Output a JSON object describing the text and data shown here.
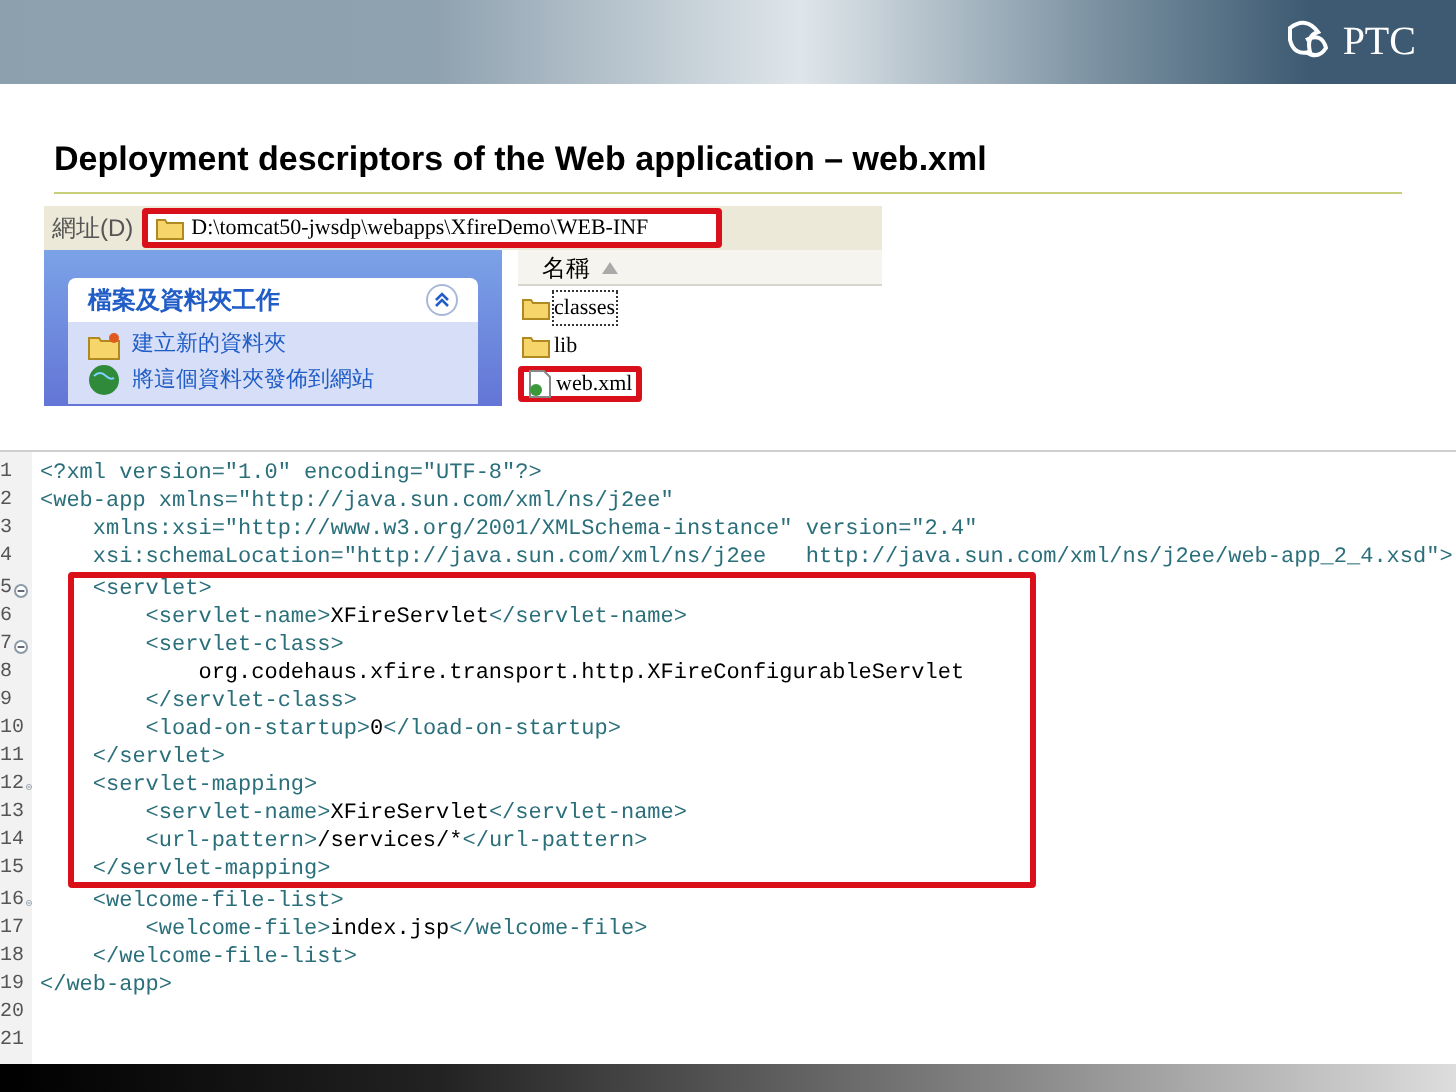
{
  "header": {
    "logo": "PTC"
  },
  "title": "Deployment descriptors of the Web application – web.xml",
  "explorer": {
    "address_label": "網址(D)",
    "address": "D:\\tomcat50-jwsdp\\webapps\\XfireDemo\\WEB-INF",
    "address_highlighted": true,
    "task_panel": {
      "title": "檔案及資料夾工作",
      "expanded": true,
      "tasks": [
        {
          "label": "建立新的資料夾",
          "kind": "folder"
        },
        {
          "label": "將這個資料夾發佈到網站",
          "kind": "globe"
        }
      ]
    },
    "column": "名稱",
    "files": [
      {
        "name": "classes",
        "kind": "folder",
        "selected": true,
        "highlighted": false
      },
      {
        "name": "lib",
        "kind": "folder",
        "selected": false,
        "highlighted": false
      },
      {
        "name": "web.xml",
        "kind": "xml",
        "selected": false,
        "highlighted": true
      }
    ]
  },
  "code": [
    {
      "highlighted": false,
      "lines": [
        {
          "number": "1",
          "foldable": false,
          "segments": [
            {
              "kind": "markup",
              "text": "<?xml version=\"1.0\" encoding=\"UTF-8\"?>"
            }
          ]
        },
        {
          "number": "2",
          "foldable": false,
          "segments": [
            {
              "kind": "markup",
              "text": "<web-app xmlns=\"http://java.sun.com/xml/ns/j2ee\""
            }
          ]
        },
        {
          "number": "3",
          "foldable": false,
          "segments": [
            {
              "kind": "markup",
              "text": "    xmlns:xsi=\"http://www.w3.org/2001/XMLSchema-instance\" version=\"2.4\""
            }
          ]
        },
        {
          "number": "4",
          "foldable": false,
          "segments": [
            {
              "kind": "markup",
              "text": "    xsi:schemaLocation=\"http://java.sun.com/xml/ns/j2ee   http://java.sun.com/xml/ns/j2ee/web-app_2_4.xsd\">"
            }
          ]
        }
      ]
    },
    {
      "highlighted": true,
      "lines": [
        {
          "number": "5",
          "foldable": true,
          "segments": [
            {
              "kind": "markup",
              "text": "    <servlet>"
            }
          ]
        },
        {
          "number": "6",
          "foldable": false,
          "segments": [
            {
              "kind": "markup",
              "text": "        <servlet-name>"
            },
            {
              "kind": "content",
              "text": "XFireServlet"
            },
            {
              "kind": "markup",
              "text": "</servlet-name>"
            }
          ]
        },
        {
          "number": "7",
          "foldable": true,
          "segments": [
            {
              "kind": "markup",
              "text": "        <servlet-class>"
            }
          ]
        },
        {
          "number": "8",
          "foldable": false,
          "segments": [
            {
              "kind": "content",
              "text": "            org.codehaus.xfire.transport.http.XFireConfigurableServlet"
            }
          ]
        },
        {
          "number": "9",
          "foldable": false,
          "segments": [
            {
              "kind": "markup",
              "text": "        </servlet-class>"
            }
          ]
        },
        {
          "number": "10",
          "foldable": false,
          "segments": [
            {
              "kind": "markup",
              "text": "        <load-on-startup>"
            },
            {
              "kind": "content",
              "text": "0"
            },
            {
              "kind": "markup",
              "text": "</load-on-startup>"
            }
          ]
        },
        {
          "number": "11",
          "foldable": false,
          "segments": [
            {
              "kind": "markup",
              "text": "    </servlet>"
            }
          ]
        },
        {
          "number": "12",
          "foldable": true,
          "segments": [
            {
              "kind": "markup",
              "text": "    <servlet-mapping>"
            }
          ]
        },
        {
          "number": "13",
          "foldable": false,
          "segments": [
            {
              "kind": "markup",
              "text": "        <servlet-name>"
            },
            {
              "kind": "content",
              "text": "XFireServlet"
            },
            {
              "kind": "markup",
              "text": "</servlet-name>"
            }
          ]
        },
        {
          "number": "14",
          "foldable": false,
          "segments": [
            {
              "kind": "markup",
              "text": "        <url-pattern>"
            },
            {
              "kind": "content",
              "text": "/services/*"
            },
            {
              "kind": "markup",
              "text": "</url-pattern>"
            }
          ]
        },
        {
          "number": "15",
          "foldable": false,
          "segments": [
            {
              "kind": "markup",
              "text": "    </servlet-mapping>"
            }
          ]
        }
      ]
    },
    {
      "highlighted": false,
      "lines": [
        {
          "number": "16",
          "foldable": true,
          "segments": [
            {
              "kind": "markup",
              "text": "    <welcome-file-list>"
            }
          ]
        },
        {
          "number": "17",
          "foldable": false,
          "segments": [
            {
              "kind": "markup",
              "text": "        <welcome-file>"
            },
            {
              "kind": "content",
              "text": "index.jsp"
            },
            {
              "kind": "markup",
              "text": "</welcome-file>"
            }
          ]
        },
        {
          "number": "18",
          "foldable": false,
          "segments": [
            {
              "kind": "markup",
              "text": "    </welcome-file-list>"
            }
          ]
        },
        {
          "number": "19",
          "foldable": false,
          "segments": [
            {
              "kind": "markup",
              "text": "</web-app>"
            }
          ]
        },
        {
          "number": "20",
          "foldable": false
        },
        {
          "number": "21",
          "foldable": false
        }
      ]
    }
  ]
}
